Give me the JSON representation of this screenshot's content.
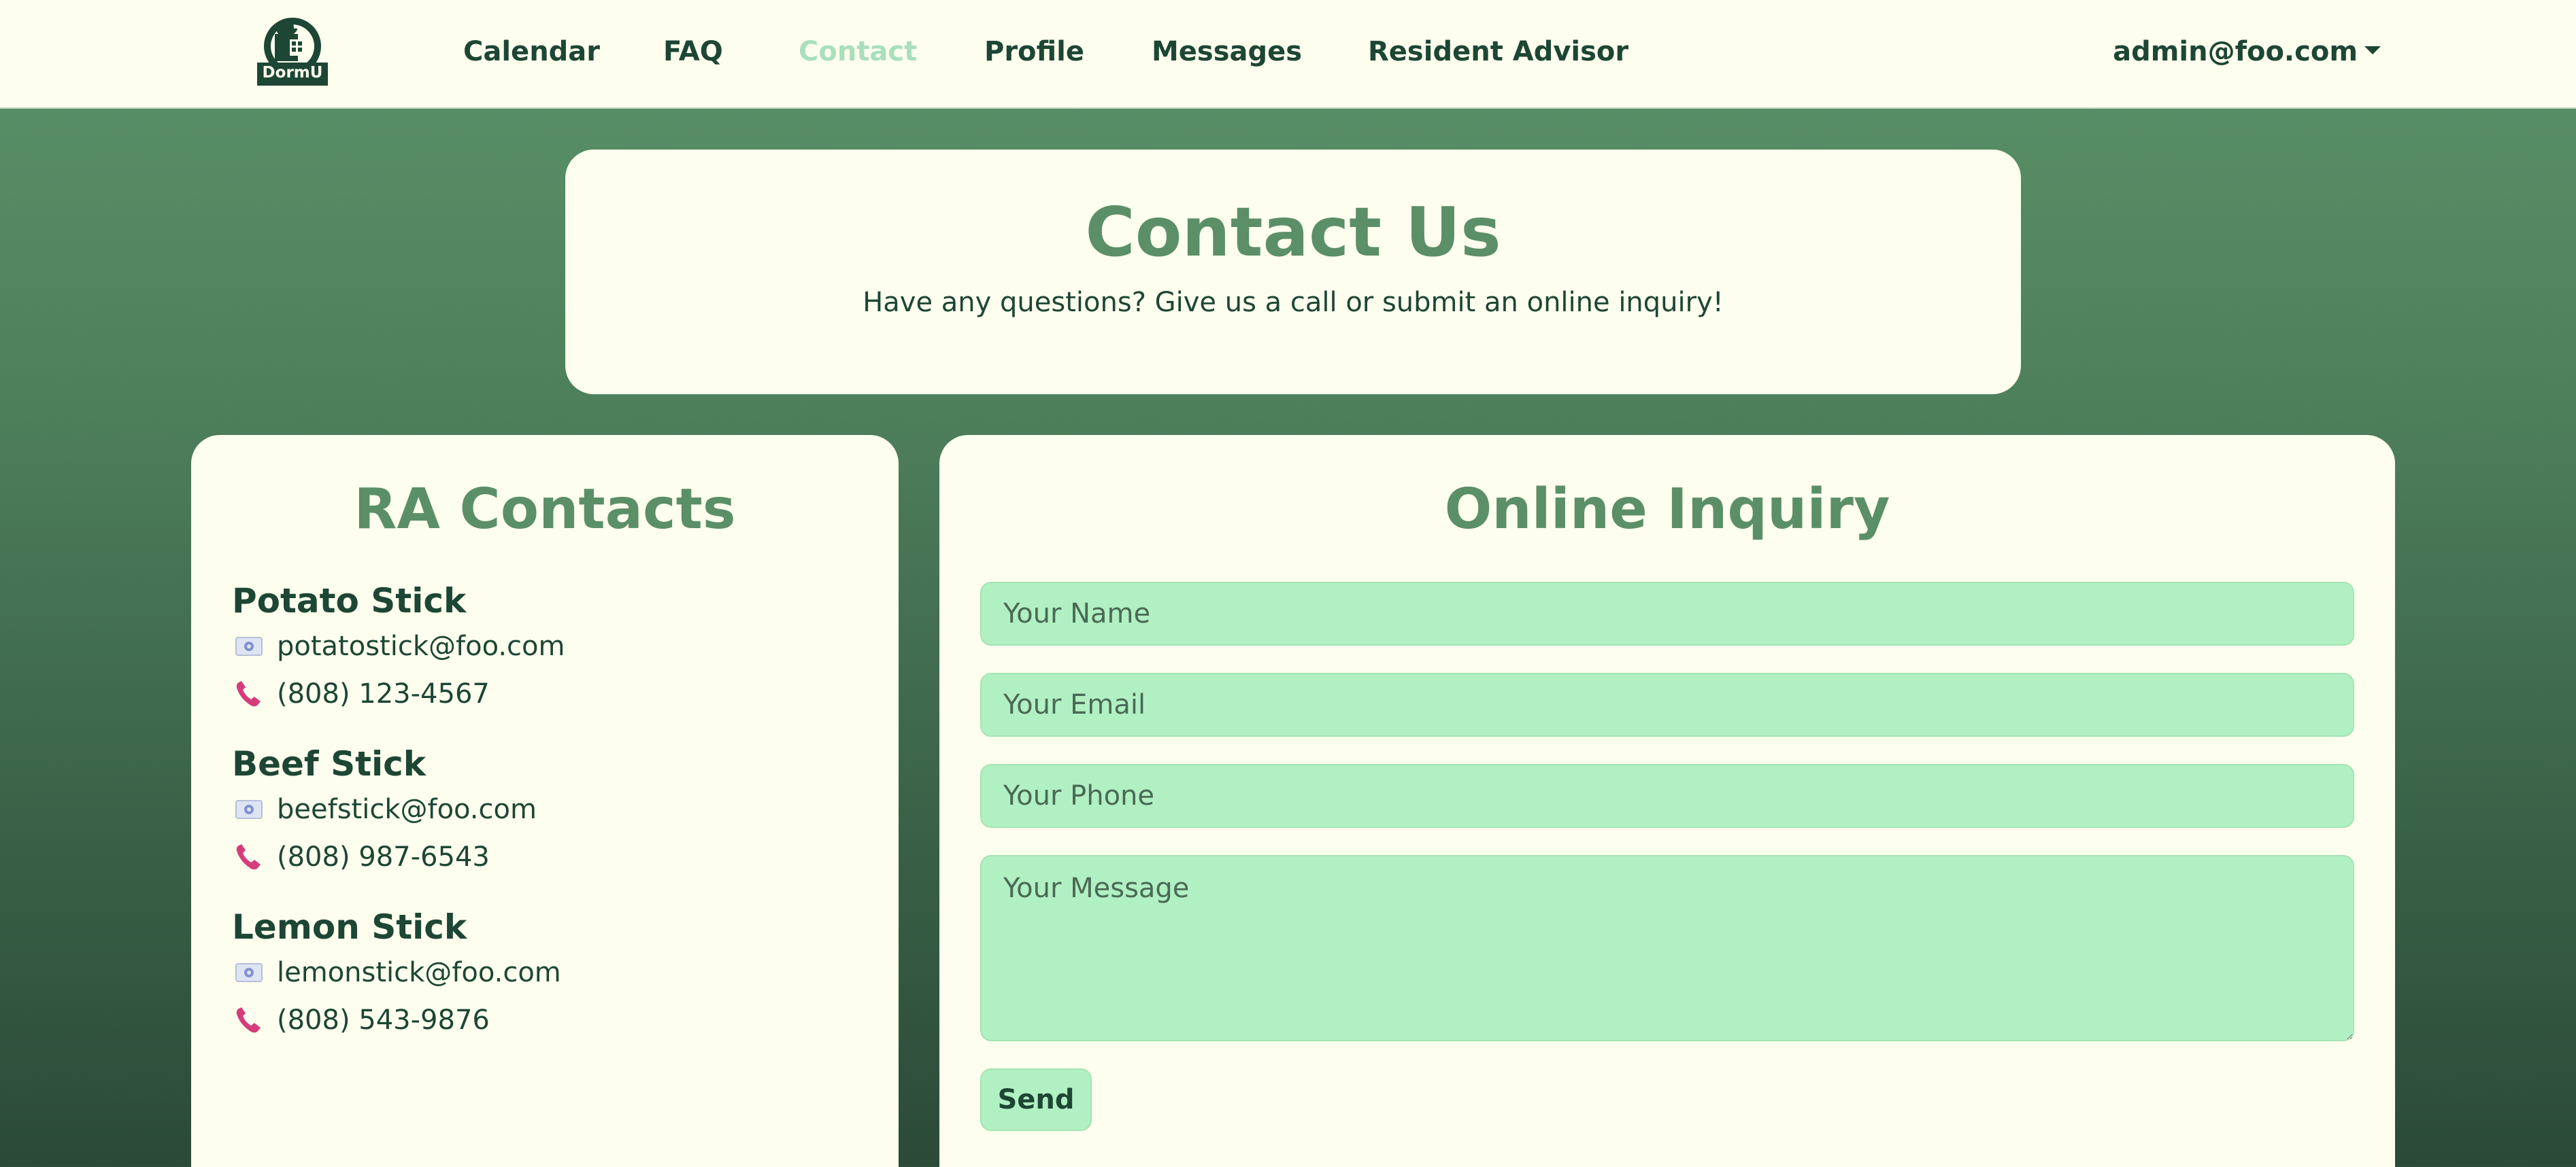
{
  "nav": {
    "logo_text": "DormU",
    "links": [
      "Calendar",
      "FAQ",
      "Contact",
      "Profile",
      "Messages",
      "Resident Advisor"
    ],
    "active": "Contact",
    "user": "admin@foo.com"
  },
  "hero": {
    "title": "Contact Us",
    "subtitle": "Have any questions? Give us a call or submit an online inquiry!"
  },
  "ra": {
    "title": "RA Contacts",
    "contacts": [
      {
        "name": "Potato Stick",
        "email": "potatostick@foo.com",
        "phone": "(808) 123-4567"
      },
      {
        "name": "Beef Stick",
        "email": "beefstick@foo.com",
        "phone": "(808) 987-6543"
      },
      {
        "name": "Lemon Stick",
        "email": "lemonstick@foo.com",
        "phone": "(808) 543-9876"
      }
    ],
    "email_icon": "email-icon",
    "phone_icon": "phone-icon"
  },
  "inquiry": {
    "title": "Online Inquiry",
    "name_placeholder": "Your Name",
    "email_placeholder": "Your Email",
    "phone_placeholder": "Your Phone",
    "message_placeholder": "Your Message",
    "send_label": "Send"
  },
  "colors": {
    "accent": "#5b8f68",
    "field": "#b1f0c3",
    "card": "#fefeee",
    "active_link": "#a9dfbb",
    "text": "#1d4634"
  }
}
